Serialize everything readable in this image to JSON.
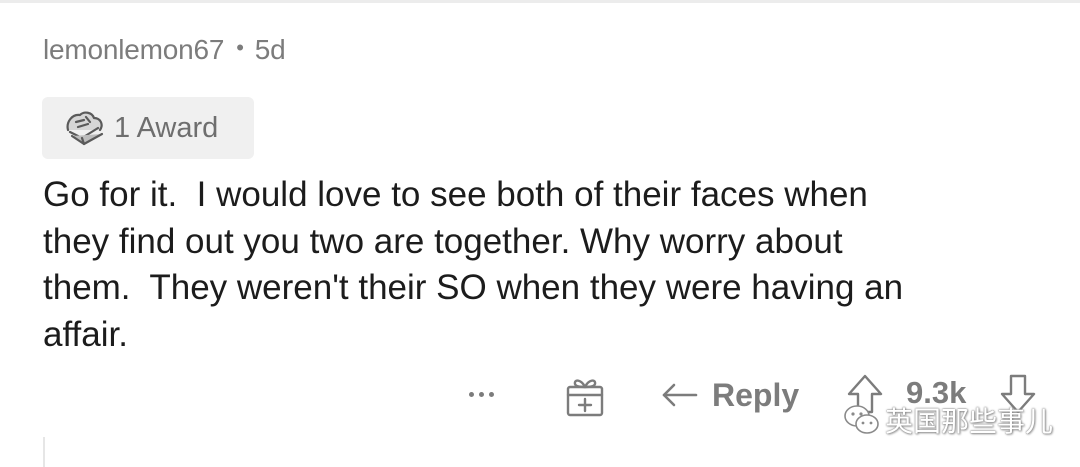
{
  "comment": {
    "author": "lemonlemon67",
    "separator": "•",
    "age": "5d",
    "award_label": "1 Award",
    "body": "Go for it.  I would love to see both of their faces when\nthey find out you two are together. Why worry about\nthem.  They weren't their SO when they were having an\naffair."
  },
  "actions": {
    "more_icon": "ellipsis-icon",
    "gift_icon": "gift-award-icon",
    "reply_label": "Reply",
    "score": "9.3k",
    "upvote_icon": "upvote-arrow-icon",
    "downvote_icon": "downvote-arrow-icon"
  },
  "watermark": {
    "text": "英国那些事儿"
  },
  "colors": {
    "meta_gray": "#7c7c7c",
    "chip_bg": "#f0f0f0",
    "body_text": "#1c1c1c"
  }
}
